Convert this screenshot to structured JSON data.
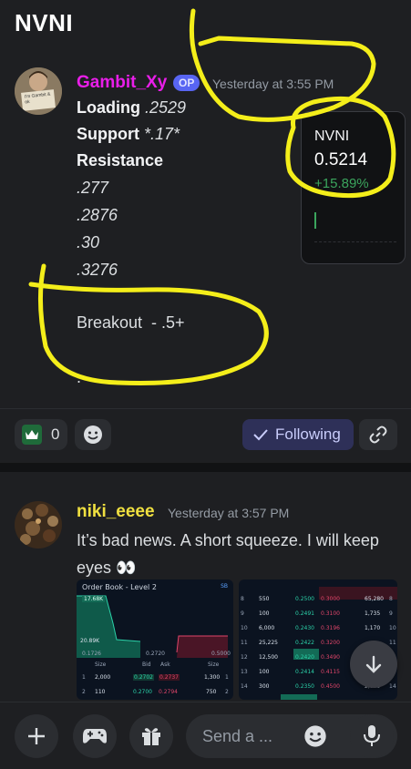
{
  "header": {
    "title": "NVNI"
  },
  "message1": {
    "author": "Gambit_Xy",
    "author_color": "#e91ee9",
    "badge": "OP",
    "timestamp": "Yesterday at 3:55 PM",
    "avatar_sign": "I'm Gambit & ok",
    "lines": {
      "loading_label": "Loading",
      "loading_value": ".2529",
      "support_label": "Support",
      "support_value": "*.17*",
      "resistance_label": "Resistance",
      "r1": ".277",
      "r2": ".2876",
      "r3": ".30",
      "r4": ".3276",
      "breakout": "Breakout  - .5+",
      "dot": "."
    },
    "ticker": {
      "symbol": "NVNI",
      "price": "0.5214",
      "change": "+15.89%",
      "change_color": "#3ba55d"
    }
  },
  "reactions": {
    "crown_count": "0",
    "following_label": "Following"
  },
  "message2": {
    "author": "niki_eeee",
    "author_color": "#f0e040",
    "timestamp": "Yesterday at 3:57 PM",
    "text": "It’s bad news. A short squeeze. I will keep eyes 👀",
    "order_book": {
      "title": "Order Book - Level 2",
      "badge": "SB",
      "top_value": "17.68K",
      "mid_value": "20.89K",
      "axis": [
        "0.1726",
        "0.2720",
        "0.5000"
      ],
      "head": [
        "Size",
        "Bid",
        "Ask",
        "Size"
      ],
      "rows": [
        [
          "1",
          "2,000",
          "0.2702",
          "0.2737",
          "1,300",
          "1"
        ],
        [
          "2",
          "110",
          "0.2700",
          "0.2794",
          "750",
          "2"
        ]
      ]
    },
    "book_right": {
      "rows": [
        [
          "8",
          "550",
          "0.2500",
          "0.3000",
          "65,280",
          "8"
        ],
        [
          "9",
          "100",
          "0.2491",
          "0.3100",
          "1,735",
          "9"
        ],
        [
          "10",
          "6,000",
          "0.2430",
          "0.3196",
          "1,170",
          "10"
        ],
        [
          "11",
          "25,225",
          "0.2422",
          "0.3200",
          "",
          "11"
        ],
        [
          "12",
          "12,500",
          "0.2420",
          "0.3490",
          "",
          ""
        ],
        [
          "13",
          "100",
          "0.2414",
          "0.4115",
          "",
          ""
        ],
        [
          "14",
          "300",
          "0.2350",
          "0.4500",
          "2,000",
          "14"
        ]
      ]
    }
  },
  "composer": {
    "placeholder": "Send a ..."
  }
}
